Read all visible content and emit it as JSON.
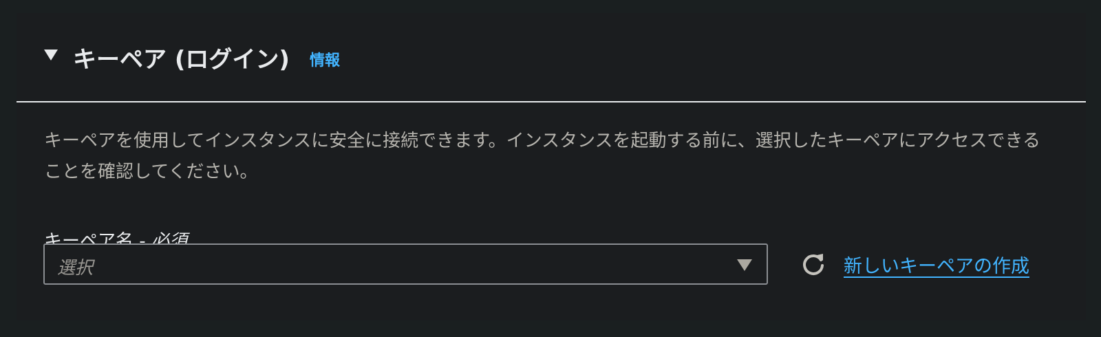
{
  "section": {
    "title": "キーペア (ログイン)",
    "info_link": "情報",
    "description": "キーペアを使用してインスタンスに安全に接続できます。インスタンスを起動する前に、選択したキーペアにアクセスできることを確認してください。"
  },
  "key_pair_field": {
    "label": "キーペア名",
    "separator": " - ",
    "required_label": "必須",
    "placeholder": "選択",
    "create_link": "新しいキーペアの作成"
  },
  "icons": {
    "collapse": "caret-down-icon",
    "dropdown": "dropdown-arrow-icon",
    "refresh": "refresh-icon"
  },
  "colors": {
    "panel_background": "#1b1d1f",
    "page_background": "#1a1f20",
    "link": "#42b4ff",
    "text": "#e9ebed",
    "muted_text": "#b6b4ae"
  }
}
